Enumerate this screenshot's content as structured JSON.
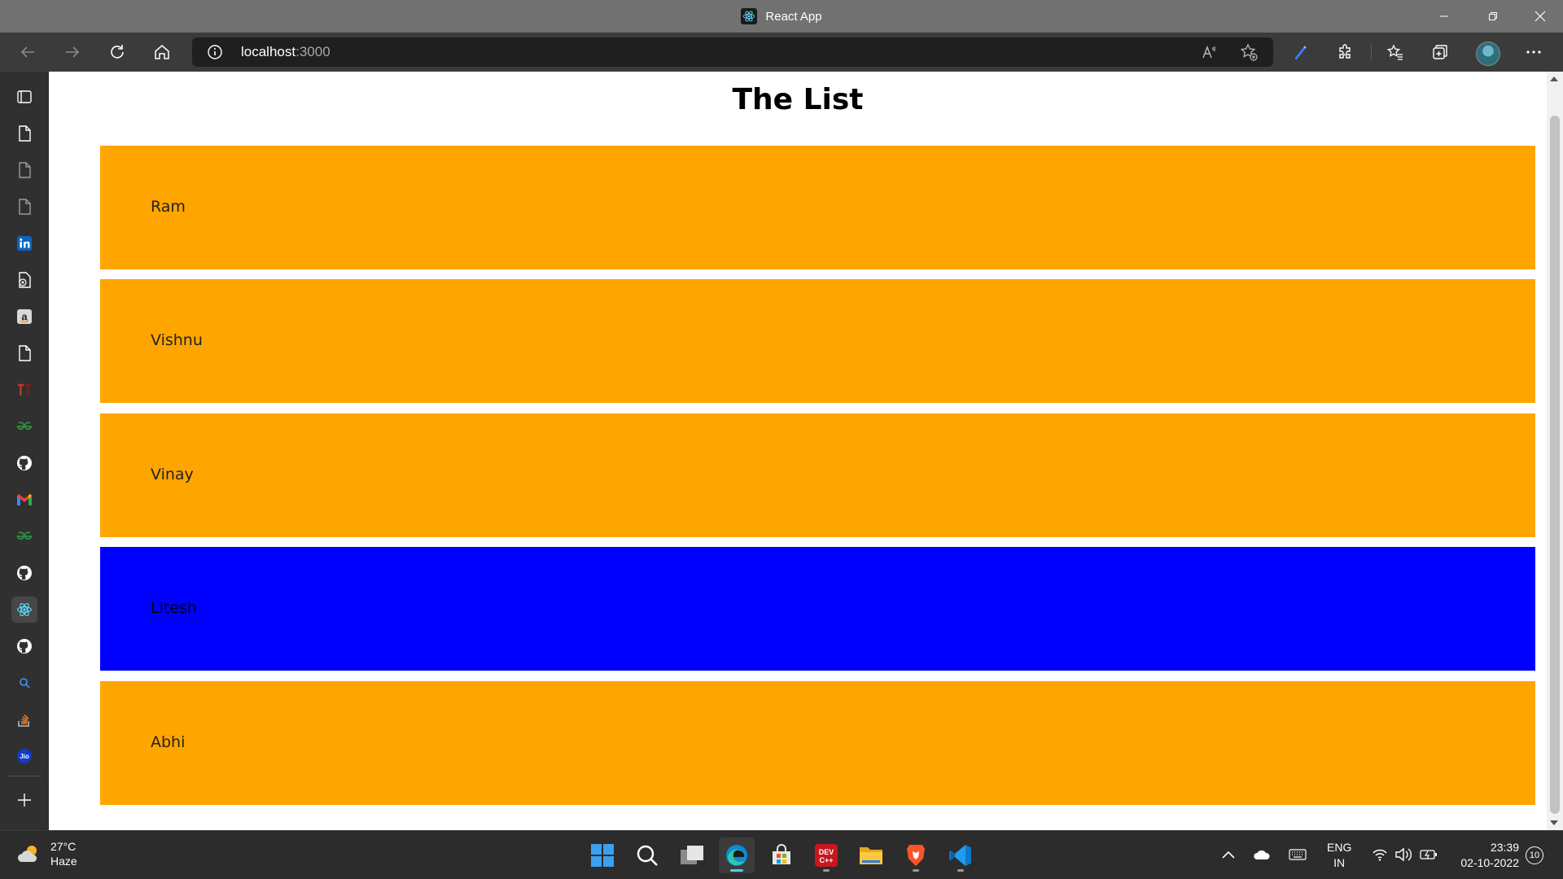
{
  "window": {
    "title": "React App",
    "tab_favicon": "react-icon"
  },
  "toolbar": {
    "url_host": "localhost",
    "url_port": ":3000",
    "icons": [
      "back-icon",
      "forward-icon",
      "refresh-icon",
      "home-icon",
      "site-info-icon",
      "read-aloud-icon",
      "add-favorite-icon",
      "copilot-pen-icon",
      "extensions-icon",
      "favorites-icon",
      "collections-icon",
      "profile-avatar",
      "more-options-icon"
    ]
  },
  "sidebar": {
    "items": [
      "tab-actions-icon",
      "document-icon",
      "document-icon",
      "document-icon",
      "linkedin-icon",
      "document-x-icon",
      "amazon-icon",
      "document-icon",
      "tracker-icon",
      "geeksforgeeks-icon",
      "github-icon",
      "gmail-icon",
      "geeksforgeeks-icon",
      "github-icon",
      "react-icon",
      "github-icon",
      "search-icon",
      "stackoverflow-icon",
      "jio-icon",
      "add-icon"
    ],
    "active_index": 14
  },
  "page": {
    "title": "The List",
    "items": [
      {
        "name": "Ram",
        "selected": false
      },
      {
        "name": "Vishnu",
        "selected": false
      },
      {
        "name": "Vinay",
        "selected": false
      },
      {
        "name": "Litesh",
        "selected": true
      },
      {
        "name": "Abhi",
        "selected": false
      }
    ],
    "colors": {
      "item": "#ffa500",
      "selected_item": "#0000ff"
    }
  },
  "taskbar": {
    "weather": {
      "temp": "27°C",
      "condition": "Haze"
    },
    "apps": [
      "windows-start-icon",
      "search-icon",
      "task-view-icon",
      "edge-icon",
      "store-icon",
      "devcpp-icon",
      "file-explorer-icon",
      "brave-icon",
      "vscode-icon"
    ],
    "language": {
      "line1": "ENG",
      "line2": "IN"
    },
    "clock": {
      "time": "23:39",
      "date": "02-10-2022"
    },
    "notifications": "10"
  }
}
